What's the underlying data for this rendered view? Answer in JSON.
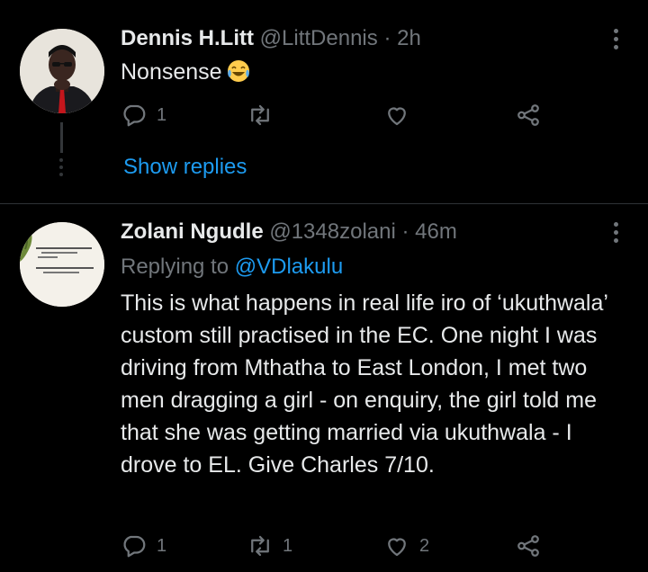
{
  "tweets": [
    {
      "name": "Dennis H.Litt",
      "handle": "@LittDennis",
      "separator": "·",
      "time": "2h",
      "text": "Nonsense",
      "emoji": "face-with-tears-of-joy",
      "reply_count": "1",
      "retweet_count": "",
      "like_count": "",
      "show_replies": "Show replies"
    },
    {
      "name": "Zolani Ngudle",
      "handle": "@1348zolani",
      "separator": "·",
      "time": "46m",
      "replying_prefix": "Replying to",
      "replying_to": "@VDlakulu",
      "text": "This is what happens in real life iro of ‘ukuthwala’ custom still practised in the EC. One night I was driving from Mthatha to East London, I met two men dragging a girl - on enquiry, the girl told me that she was getting married via ukuthwala - I drove to EL. Give Charles 7/10.",
      "reply_count": "1",
      "retweet_count": "1",
      "like_count": "2",
      "avatar_quote": "\"If there ever comes a day when we can't be together... Keep me in your heart, I'll stay there forever.\""
    }
  ],
  "colors": {
    "background": "#000000",
    "text": "#e7e9ea",
    "muted": "#71767b",
    "accent": "#1d9bf0",
    "divider": "#2f3336"
  }
}
